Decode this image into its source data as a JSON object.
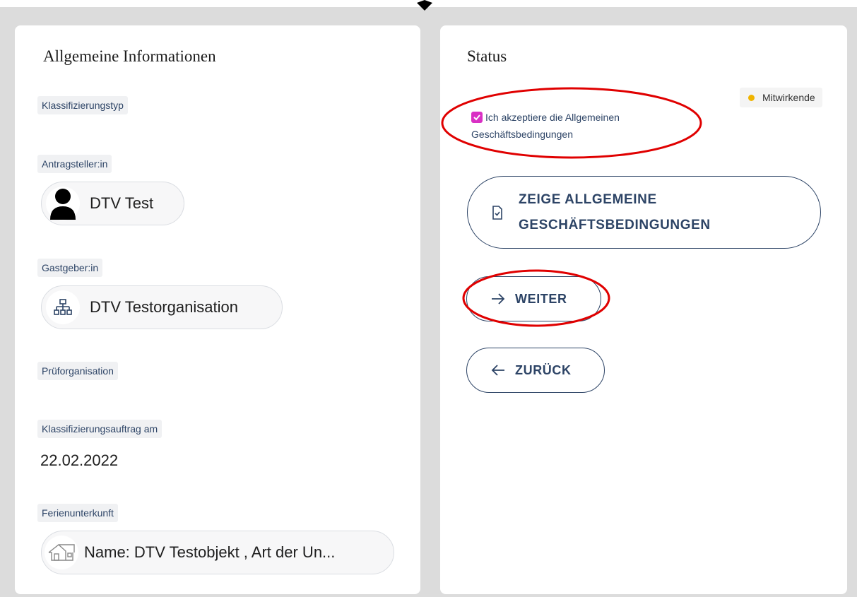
{
  "general": {
    "title": "Allgemeine Informationen",
    "fields": {
      "classification_type_label": "Klassifizierungstyp",
      "applicant_label": "Antragsteller:in",
      "applicant_value": "DTV Test",
      "host_label": "Gastgeber:in",
      "host_value": "DTV Testorganisation",
      "inspection_org_label": "Prüforganisation",
      "order_date_label": "Klassifizierungsauftrag am",
      "order_date_value": "22.02.2022",
      "accommodation_label": "Ferienunterkunft",
      "accommodation_value": "Name: DTV Testobjekt , Art der Un..."
    }
  },
  "status": {
    "title": "Status",
    "legend_label": "Mitwirkende",
    "legend_color": "#f0b400",
    "terms_checkbox": {
      "checked": true,
      "label_line1": "Ich akzeptiere die Allgemeinen",
      "label_line2": "Geschäftsbedingungen"
    },
    "buttons": {
      "show_terms_line1": "ZEIGE ALLGEMEINE",
      "show_terms_line2": "GESCHÄFTSBEDINGUNGEN",
      "next": "WEITER",
      "back": "ZURÜCK"
    }
  },
  "colors": {
    "accent": "#2d4466",
    "checkbox": "#d930c4",
    "annotation": "#e00000"
  }
}
